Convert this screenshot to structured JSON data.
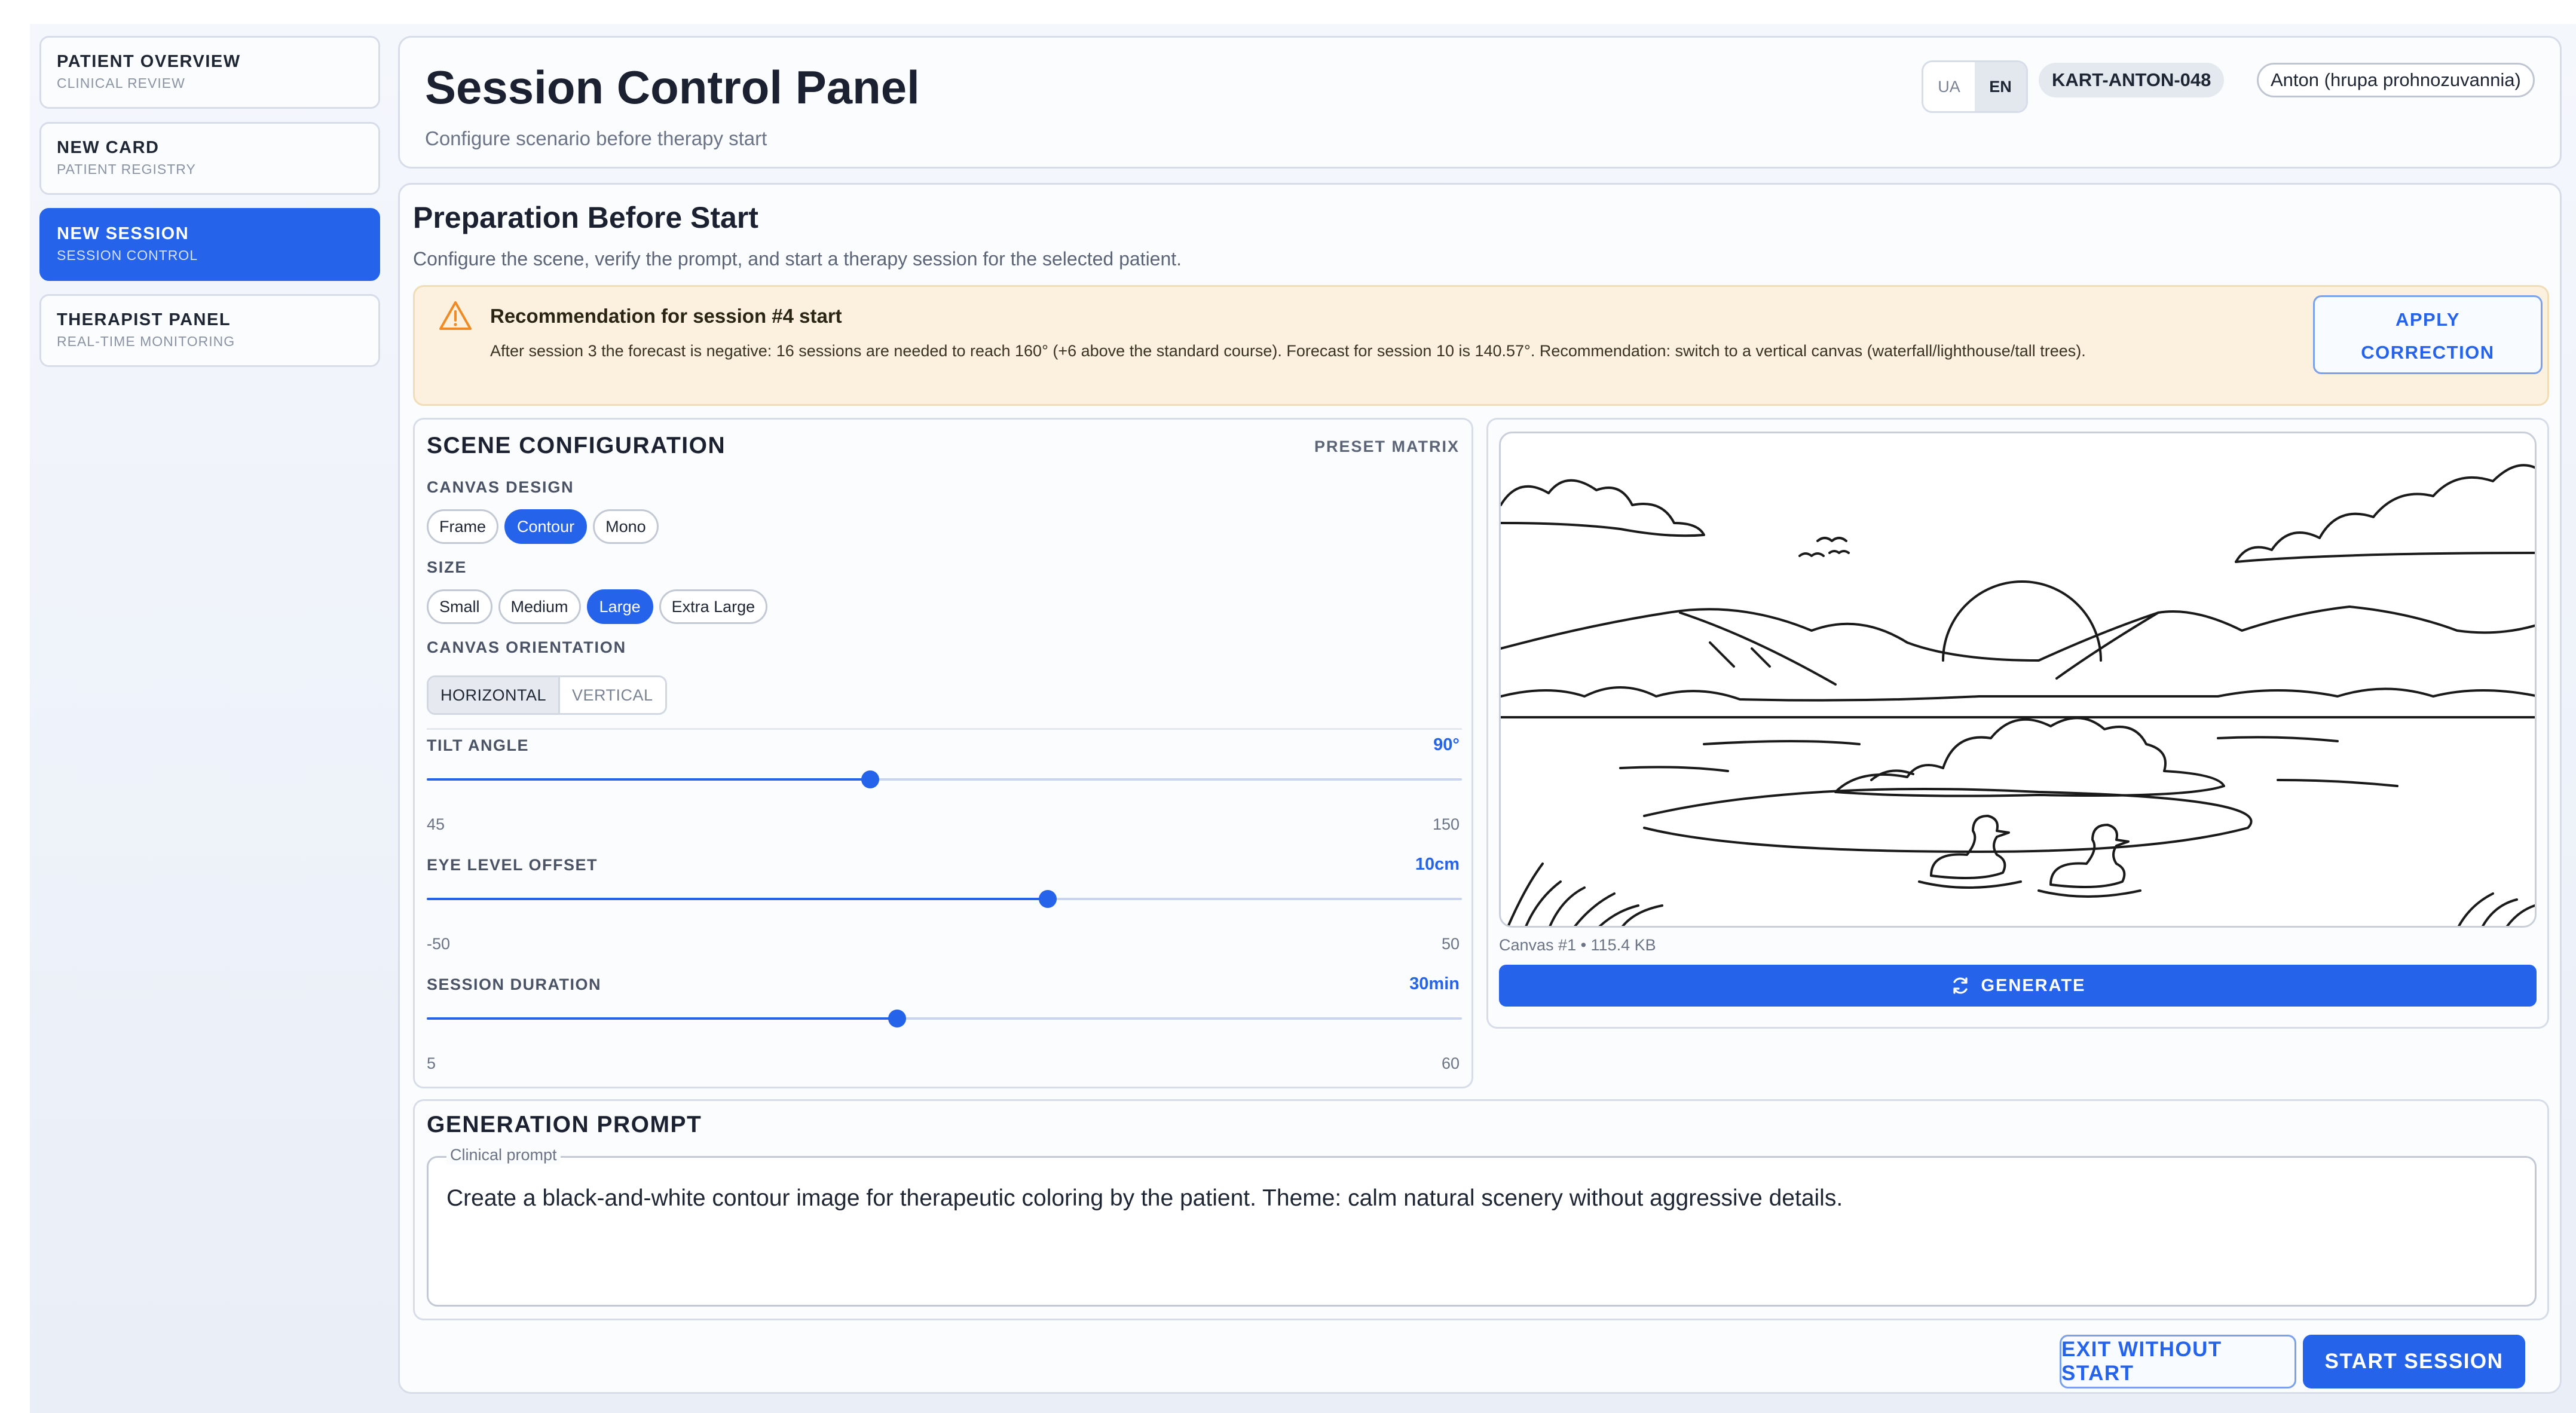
{
  "sidebar": {
    "items": [
      {
        "title": "PATIENT OVERVIEW",
        "subtitle": "CLINICAL REVIEW",
        "active": false
      },
      {
        "title": "NEW CARD",
        "subtitle": "PATIENT REGISTRY",
        "active": false
      },
      {
        "title": "NEW SESSION",
        "subtitle": "SESSION CONTROL",
        "active": true
      },
      {
        "title": "THERAPIST PANEL",
        "subtitle": "REAL-TIME MONITORING",
        "active": false
      }
    ]
  },
  "header": {
    "title": "Session Control Panel",
    "subtitle": "Configure scenario before therapy start",
    "languages": [
      "UA",
      "EN"
    ],
    "active_language": "EN",
    "card_id": "KART-ANTON-048",
    "patient_name": "Anton (hrupa prohnozuvannia)"
  },
  "preparation": {
    "title": "Preparation Before Start",
    "subtitle": "Configure the scene, verify the prompt, and start a therapy session for the selected patient."
  },
  "alert": {
    "title": "Recommendation for session #4 start",
    "text": "After session 3 the forecast is negative: 16 sessions are needed to reach 160° (+6 above the standard course). Forecast for session 10 is 140.57°. Recommendation: switch to a vertical canvas (waterfall/lighthouse/tall trees).",
    "action_line1": "APPLY",
    "action_line2": "CORRECTION",
    "icon": "warning-triangle-icon",
    "color": "#f59e0b"
  },
  "scene": {
    "title": "SCENE CONFIGURATION",
    "preset_label": "PRESET MATRIX",
    "canvas_design": {
      "label": "CANVAS DESIGN",
      "options": [
        "Frame",
        "Contour",
        "Mono"
      ],
      "selected": "Contour"
    },
    "size": {
      "label": "SIZE",
      "options": [
        "Small",
        "Medium",
        "Large",
        "Extra Large"
      ],
      "selected": "Large"
    },
    "orientation": {
      "label": "CANVAS ORIENTATION",
      "options": [
        "HORIZONTAL",
        "VERTICAL"
      ],
      "selected": "HORIZONTAL"
    },
    "sliders": [
      {
        "label": "TILT ANGLE",
        "value_text": "90°",
        "value": 90,
        "min": 45,
        "max": 150,
        "min_text": "45",
        "max_text": "150"
      },
      {
        "label": "EYE LEVEL OFFSET",
        "value_text": "10cm",
        "value": 10,
        "min": -50,
        "max": 50,
        "min_text": "-50",
        "max_text": "50"
      },
      {
        "label": "SESSION DURATION",
        "value_text": "30min",
        "value": 30,
        "min": 5,
        "max": 60,
        "min_text": "5",
        "max_text": "60"
      }
    ]
  },
  "preview": {
    "caption": "Canvas #1 • 115.4 KB",
    "generate_label": "GENERATE",
    "generate_icon": "refresh-icon"
  },
  "prompt": {
    "title": "GENERATION PROMPT",
    "field_label": "Clinical prompt",
    "value": "Create a black-and-white contour image for therapeutic coloring by the patient. Theme: calm natural scenery without aggressive details."
  },
  "footer": {
    "exit_label": "EXIT WITHOUT START",
    "start_label": "START SESSION"
  },
  "colors": {
    "accent": "#2563eb",
    "alert_bg": "#fbf1de"
  }
}
